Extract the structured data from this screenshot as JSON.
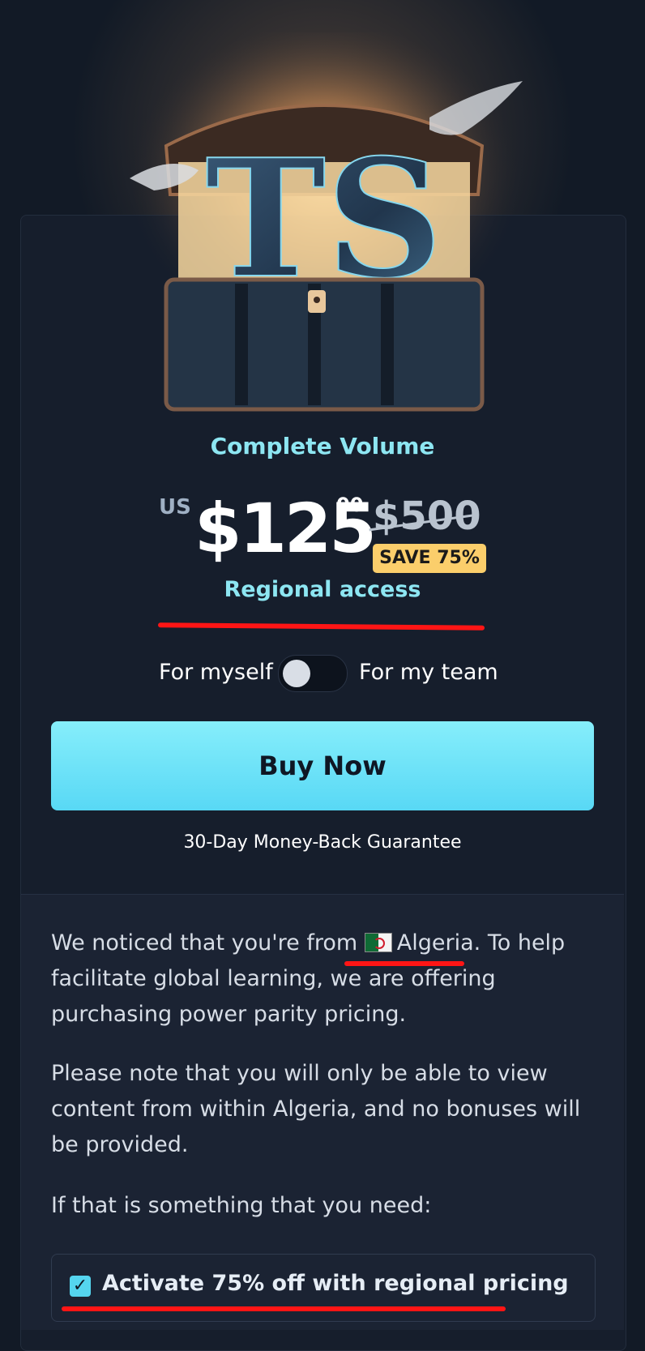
{
  "product": {
    "title": "Complete Volume"
  },
  "pricing": {
    "currency": "US",
    "price": "$125",
    "cents": "00",
    "original_price": "$500",
    "save_badge": "SAVE 75%",
    "access_label": "Regional access"
  },
  "toggle": {
    "left_label": "For myself",
    "right_label": "For my team",
    "state": "myself"
  },
  "cta": {
    "buy_label": "Buy Now",
    "guarantee": "30-Day Money-Back Guarantee"
  },
  "notice": {
    "p1_prefix": "We noticed that you're from",
    "country": "Algeria",
    "p1_suffix": ". To help facilitate global learning, we are offering purchasing power parity pricing.",
    "p2": "Please note that you will only be able to view content from within Algeria, and no bonuses will be provided.",
    "p3": "If that is something that you need:"
  },
  "activate": {
    "checked": true,
    "label": "Activate 75% off with regional pricing"
  },
  "colors": {
    "accent": "#8de6f2",
    "button": "#58d8f5",
    "badge": "#fbce6b",
    "annotation": "#ff1515"
  },
  "hero_logo_text": "TS"
}
